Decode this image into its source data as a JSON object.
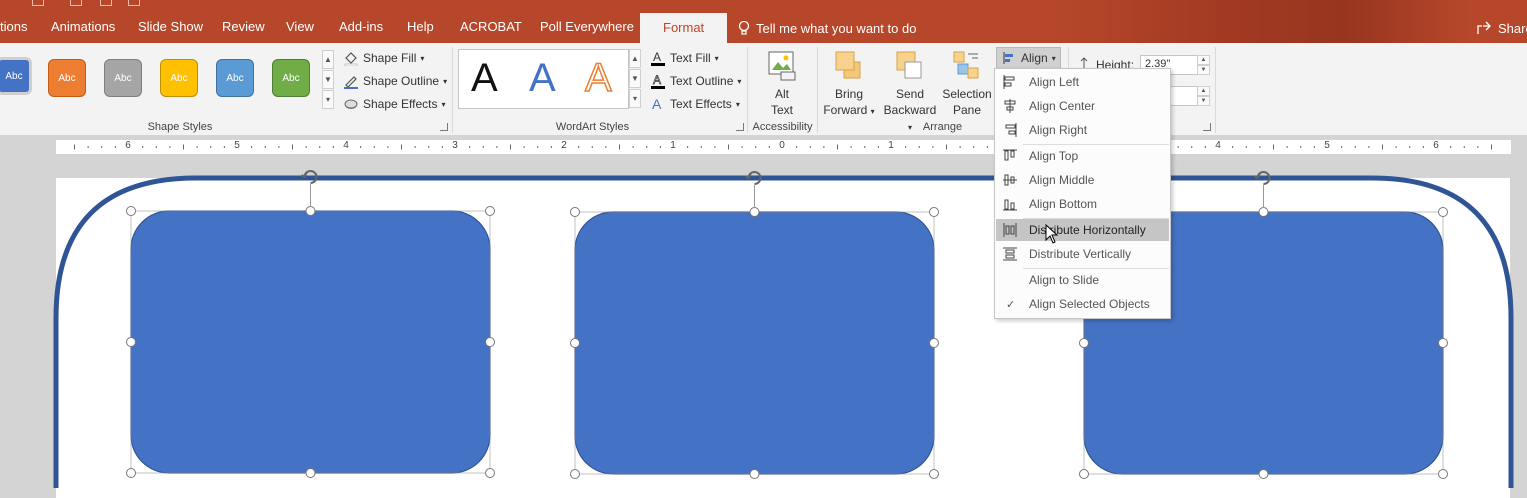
{
  "tabs": [
    "tions",
    "Animations",
    "Slide Show",
    "Review",
    "View",
    "Add-ins",
    "Help",
    "ACROBAT",
    "Poll Everywhere"
  ],
  "active_tab": "Format",
  "tell_me": "Tell me what you want to do",
  "share": "Share",
  "shape_styles": {
    "label": "Shape Styles",
    "swatches": [
      {
        "text": "Abc",
        "color": "#4472c4"
      },
      {
        "text": "Abc",
        "color": "#ed7d31"
      },
      {
        "text": "Abc",
        "color": "#a5a5a5"
      },
      {
        "text": "Abc",
        "color": "#ffc000"
      },
      {
        "text": "Abc",
        "color": "#5b9bd5"
      },
      {
        "text": "Abc",
        "color": "#70ad47"
      }
    ],
    "shape_fill": "Shape Fill",
    "shape_outline": "Shape Outline",
    "shape_effects": "Shape Effects"
  },
  "wordart": {
    "label": "WordArt Styles",
    "samples": [
      "A",
      "A",
      "A"
    ],
    "text_fill": "Text Fill",
    "text_outline": "Text Outline",
    "text_effects": "Text Effects"
  },
  "accessibility": {
    "label": "Accessibility",
    "alt_text_1": "Alt",
    "alt_text_2": "Text"
  },
  "arrange": {
    "label": "Arrange",
    "bring_forward_1": "Bring",
    "bring_forward_2": "Forward",
    "send_backward_1": "Send",
    "send_backward_2": "Backward",
    "selection_pane_1": "Selection",
    "selection_pane_2": "Pane",
    "align": "Align"
  },
  "size": {
    "height_label": "Height:",
    "height_value": "2.39\""
  },
  "ruler_numbers": [
    "6",
    "5",
    "4",
    "3",
    "2",
    "1",
    "0",
    "1",
    "2",
    "3",
    "4",
    "5",
    "6"
  ],
  "align_menu": [
    {
      "label": "Align Left",
      "icon": "align-left-icon"
    },
    {
      "label": "Align Center",
      "icon": "align-center-icon"
    },
    {
      "label": "Align Right",
      "icon": "align-right-icon"
    },
    {
      "label": "Align Top",
      "icon": "align-top-icon"
    },
    {
      "label": "Align Middle",
      "icon": "align-middle-icon"
    },
    {
      "label": "Align Bottom",
      "icon": "align-bottom-icon"
    },
    {
      "label": "Distribute Horizontally",
      "icon": "distribute-horizontally-icon",
      "highlighted": true
    },
    {
      "label": "Distribute Vertically",
      "icon": "distribute-vertically-icon"
    },
    {
      "label": "Align to Slide",
      "icon": ""
    },
    {
      "label": "Align Selected Objects",
      "icon": "check-icon",
      "checked": true
    }
  ],
  "colors": {
    "accent": "#b7472a",
    "shape_fill": "#4472c4",
    "shape_border": "#2f528f",
    "outer_border": "#2f5597"
  }
}
